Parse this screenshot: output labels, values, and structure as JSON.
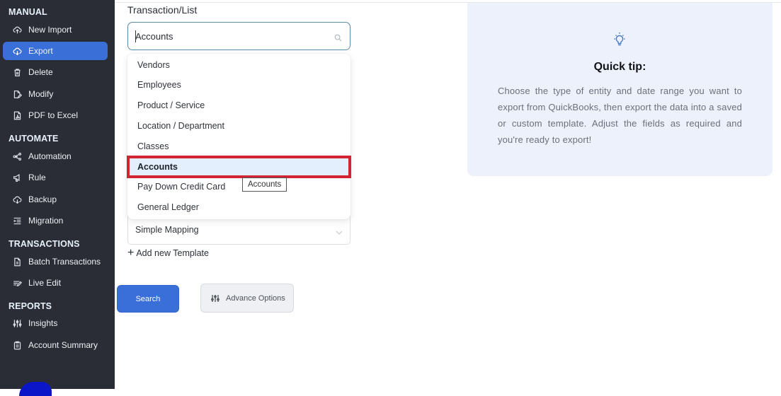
{
  "sidebar": {
    "sections": [
      {
        "title": "MANUAL",
        "items": [
          {
            "label": "New Import",
            "icon": "cloud-upload-icon",
            "active": false
          },
          {
            "label": "Export",
            "icon": "cloud-download-icon",
            "active": true
          },
          {
            "label": "Delete",
            "icon": "trash-icon",
            "active": false
          },
          {
            "label": "Modify",
            "icon": "edit-file-icon",
            "active": false
          },
          {
            "label": "PDF to Excel",
            "icon": "pdf-file-icon",
            "active": false
          }
        ]
      },
      {
        "title": "AUTOMATE",
        "items": [
          {
            "label": "Automation",
            "icon": "share-nodes-icon"
          },
          {
            "label": "Rule",
            "icon": "megaphone-icon"
          },
          {
            "label": "Backup",
            "icon": "cloud-backup-icon"
          },
          {
            "label": "Migration",
            "icon": "indent-list-icon"
          }
        ]
      },
      {
        "title": "TRANSACTIONS",
        "items": [
          {
            "label": "Batch Transactions",
            "icon": "document-icon"
          },
          {
            "label": "Live Edit",
            "icon": "live-edit-icon"
          }
        ]
      },
      {
        "title": "REPORTS",
        "items": [
          {
            "label": "Insights",
            "icon": "sliders-icon"
          },
          {
            "label": "Account Summary",
            "icon": "clipboard-icon"
          }
        ]
      }
    ]
  },
  "form": {
    "transaction_label": "Transaction/List",
    "search_value": "Accounts",
    "dropdown_options": [
      "Vendors",
      "Employees",
      "Product / Service",
      "Location / Department",
      "Classes",
      "Accounts",
      "Pay Down Credit Card",
      "General Ledger"
    ],
    "selected_option": "Accounts",
    "tooltip": "Accounts",
    "template_value": "Simple Mapping",
    "add_template_label": "Add new Template",
    "search_button": "Search",
    "advance_button": "Advance Options"
  },
  "tip": {
    "title": "Quick tip:",
    "text": "Choose the type of entity and date range you want to export from QuickBooks, then export the data into a saved or custom template. Adjust the fields as required and you're ready to export!"
  },
  "colors": {
    "sidebar_bg": "#2a2d36",
    "accent": "#3b6fd8",
    "highlight_border": "#d32433",
    "tip_bg": "#ecf1fb"
  }
}
